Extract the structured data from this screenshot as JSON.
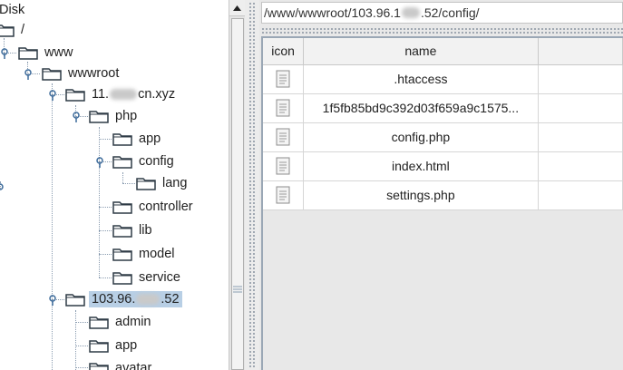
{
  "tree": {
    "disk_label": "Disk",
    "root_label": "/",
    "www_label": "www",
    "wwwroot_label": "wwwroot",
    "site1_label_prefix": "11.",
    "site1_label_suffix": "cn.xyz",
    "php_label": "php",
    "app_label": "app",
    "config_label": "config",
    "lang_label": "lang",
    "controller_label": "controller",
    "lib_label": "lib",
    "model_label": "model",
    "service_label": "service",
    "site2_label_prefix": "103.96.",
    "site2_label_suffix": ".52",
    "admin_label": "admin",
    "app2_label": "app",
    "avatar_label": "avatar"
  },
  "path_bar": {
    "prefix": "/www/wwwroot/103.96.1",
    "suffix": ".52/config/"
  },
  "file_table": {
    "headers": [
      "icon",
      "name",
      ""
    ],
    "files": [
      ".htaccess",
      "1f5fb85bd9c392d03f659a9c1575...",
      "config.php",
      "index.html",
      "settings.php"
    ]
  },
  "icons": {
    "folder": "folder-icon",
    "file": "file-icon",
    "expand": "expanded-handle-icon",
    "scroll_up": "scroll-up-arrow-icon",
    "grip": "scrollbar-grip-icon"
  },
  "colors": {
    "selection": "#b8cfe5",
    "folder_outline": "#2f3b46",
    "guide": "#8a9cb0"
  }
}
